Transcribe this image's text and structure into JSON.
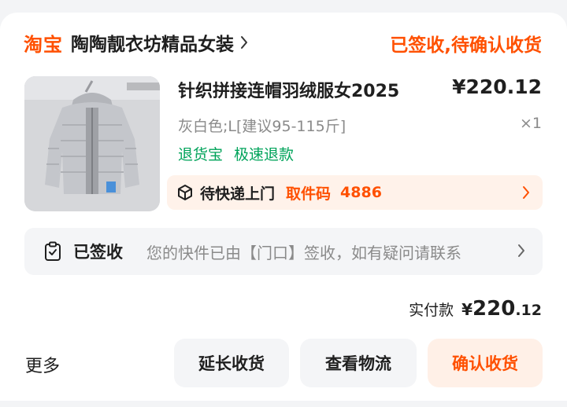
{
  "header": {
    "brand": "淘宝",
    "shop_name": "陶陶靓衣坊精品女装",
    "order_status": "已签收,待确认收货"
  },
  "item": {
    "image_icon": "padded-jacket-photo",
    "title": "针织拼接连帽羽绒服女2025",
    "price": "¥220.12",
    "variant": "灰白色;L[建议95-115斤]",
    "quantity": "×1",
    "tags": [
      "退货宝",
      "极速退款"
    ]
  },
  "pickup": {
    "icon": "package-icon",
    "status": "待快递上门",
    "code_label": "取件码",
    "code": "4886"
  },
  "logistics": {
    "icon": "clipboard-check-icon",
    "status": "已签收",
    "message": "您的快件已由【门口】签收，如有疑问请联系"
  },
  "total": {
    "label": "实付款",
    "currency": "¥",
    "integer": "220",
    "decimal": ".12"
  },
  "actions": {
    "more": "更多",
    "extend": "延长收货",
    "track": "查看物流",
    "confirm": "确认收货"
  },
  "colors": {
    "accent": "#ff5000",
    "green": "#00a35a",
    "text": "#1f1f1f",
    "muted": "#8a8a8a"
  }
}
